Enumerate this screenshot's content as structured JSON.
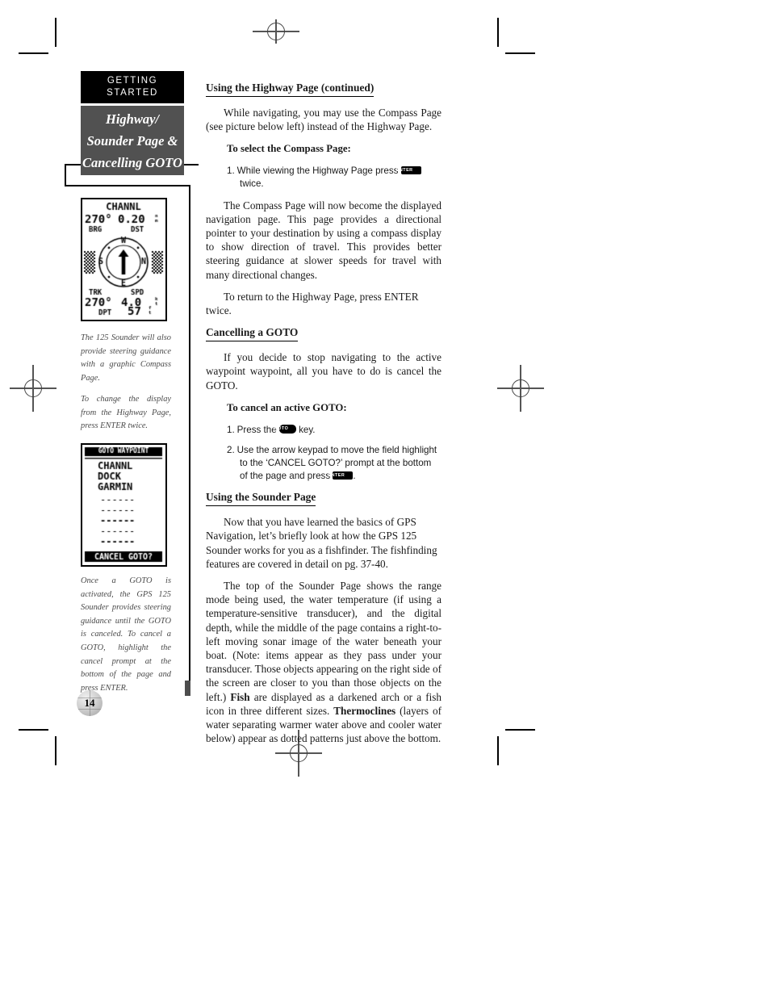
{
  "sidebar": {
    "getting_started": {
      "line1": "GETTING",
      "line2": "STARTED"
    },
    "section_tab": {
      "line1": "Highway/",
      "line2": "Sounder Page &",
      "line3": "Cancelling GOTO"
    },
    "captions": {
      "caption_1a": "The 125 Sounder will also provide steering guidance with a graphic Compass Page.",
      "caption_1b": "To change the display from the Highway Page, press ENTER twice.",
      "caption_2": "Once a GOTO is activated, the GPS 125 Sounder provides steering guidance until the GOTO is canceled. To cancel a GOTO, highlight the cancel prompt at the bottom of the page and press ENTER."
    }
  },
  "lcd_compass": {
    "title": "CHANNL",
    "bearing_value": "270°",
    "distance_value": "0.20",
    "distance_unit_top": "n",
    "distance_unit_bottom": "m",
    "label_brg": "BRG",
    "label_dst": "DST",
    "compass_n": "N",
    "compass_s": "S",
    "compass_e": "E",
    "compass_w": "W",
    "label_trk": "TRK",
    "label_spd": "SPD",
    "track_value": "270°",
    "speed_value": "4.0",
    "speed_unit_top": "k",
    "speed_unit_bottom": "t",
    "label_dpt": "DPT",
    "depth_value": "57",
    "depth_unit_top": "f",
    "depth_unit_bottom": "t"
  },
  "lcd_goto": {
    "header": "GOTO WAYPOINT",
    "waypoints": [
      "CHANNL",
      "DOCK",
      "GARMIN"
    ],
    "empty_rows": [
      "------",
      "------",
      "------",
      "------",
      "------",
      "------"
    ],
    "prompt": "CANCEL GOTO?"
  },
  "main": {
    "heading_1": "Using the Highway Page (continued)",
    "para_1": "While navigating, you may use the Compass Page (see picture below left) instead of the Highway Page.",
    "subhead_1": "To select the Compass Page:",
    "step_1": {
      "num": "1.",
      "text_before": "While viewing the Highway Page press",
      "key": "ENTER",
      "text_after": "twice."
    },
    "para_2": "The Compass Page will now become the displayed navigation page. This page provides a directional pointer to your destination by using a compass display to show direction of travel. This provides better steering guidance at slower speeds for travel with many directional changes.",
    "para_3": "To return to the Highway Page, press ENTER twice.",
    "heading_2": "Cancelling a GOTO",
    "para_4": "If you decide to stop navigating to the active waypoint waypoint, all you have to do is cancel the GOTO.",
    "subhead_2": "To cancel an active GOTO:",
    "step_2": {
      "num": "1.",
      "text_before": "Press the",
      "key": "GOTO",
      "text_after": "key."
    },
    "step_3": {
      "num": "2.",
      "text_before": "Use the arrow keypad to move the field highlight to the ‘CANCEL GOTO?’ prompt at the bottom of the page and press",
      "key": "ENTER",
      "text_after": "."
    },
    "heading_3": "Using the Sounder Page",
    "para_5": "Now that you have learned the basics of GPS Navigation, let’s briefly look at how the GPS 125 Sounder works for you as a fishfinder. The fishfinding features are covered in detail on pg. 37-40.",
    "para_6_part1": "The top of the Sounder Page shows the range mode being used, the water temperature (if using a temperature-sensitive transducer), and the digital depth, while the middle of the page contains a right-to-left moving sonar image of the water beneath your boat. (Note: items appear as they pass under your transducer. Those objects appearing on the right side of the screen are closer to you than those objects on the left.) ",
    "para_6_bold1": "Fish",
    "para_6_part2": " are displayed as a darkened arch or a fish icon in three different sizes. ",
    "para_6_bold2": "Thermoclines",
    "para_6_part3": " (layers of water separating warmer water above and cooler water below) appear as dotted patterns just above the bottom."
  },
  "page_number": "14",
  "colors": {
    "tab_dark": "#000000",
    "tab_gray": "#515151",
    "text": "#1a1a1a",
    "caption": "#4a4a4a"
  }
}
